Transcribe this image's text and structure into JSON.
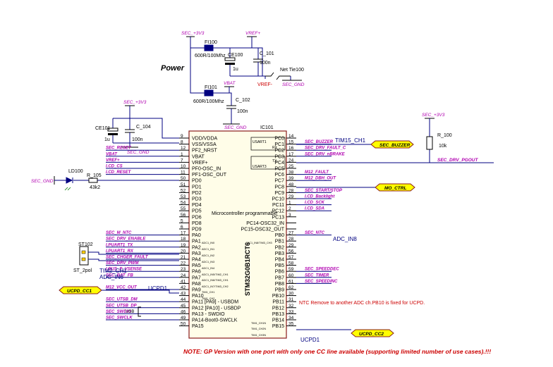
{
  "title": "Power",
  "colors": {
    "wire": "#000080",
    "netlabel": "#b000b0",
    "note": "#cc0000",
    "chip_fill": "#fffde8",
    "chip_outline": "#8a1c1c",
    "port_fill": "#ffff00"
  },
  "ic": {
    "designator": "IC101",
    "part": "STM32G0B1RCT6",
    "description": "Microcontroller programmable",
    "left_pins": [
      {
        "num": "9",
        "name": "VDD/VDDA",
        "net": ""
      },
      {
        "num": "8",
        "name": "VSS/VSSA",
        "net": ""
      },
      {
        "num": "12",
        "name": "PF2_NRST",
        "net": "SEC_RESET"
      },
      {
        "num": "1",
        "name": "VBAT",
        "net": "VBAT"
      },
      {
        "num": "7",
        "name": "VREF+",
        "net": "VREF+"
      },
      {
        "num": "10",
        "name": "PF0-OSC_IN",
        "net": "I.CD_CS"
      },
      {
        "num": "11",
        "name": "PF1-OSC_OUT",
        "net": "I.CD_RESET"
      },
      {
        "num": "50",
        "name": "PD0",
        "net": ""
      },
      {
        "num": "51",
        "name": "PD1",
        "net": ""
      },
      {
        "num": "52",
        "name": "PD2",
        "net": ""
      },
      {
        "num": "53",
        "name": "PD3",
        "net": ""
      },
      {
        "num": "54",
        "name": "PD4",
        "net": ""
      },
      {
        "num": "55",
        "name": "PD5",
        "net": ""
      },
      {
        "num": "56",
        "name": "PD6",
        "net": ""
      },
      {
        "num": "5",
        "name": "PD8",
        "net": ""
      },
      {
        "num": "6",
        "name": "PD9",
        "net": ""
      },
      {
        "num": "17",
        "name": "PA0",
        "net": "SEC_M_NTC"
      },
      {
        "num": "18",
        "name": "PA1",
        "net": "SEC_DRV_ENABLE"
      },
      {
        "num": "19",
        "name": "PA2",
        "net": "I.PUART1_TX"
      },
      {
        "num": "20",
        "name": "PA3",
        "net": "I.PUART1_RX"
      },
      {
        "num": "21",
        "name": "PA4",
        "net": "SEC_CHGER_FAULT"
      },
      {
        "num": "22",
        "name": "PA5",
        "net": "SEC_DRV_PWM"
      },
      {
        "num": "23",
        "name": "PA6",
        "net": "I.BUS_P_VSENSE"
      },
      {
        "num": "24",
        "name": "PA7",
        "net": "SEC_BAT_FB"
      },
      {
        "num": "41",
        "name": "PA8",
        "net": ""
      },
      {
        "num": "42",
        "name": "PA9",
        "net": "M12_VCC_OUT"
      },
      {
        "num": "43",
        "name": "PA10",
        "net": ""
      },
      {
        "num": "44",
        "name": "PA11 [PA9] - USBDM",
        "net": "SEC_UTSB_DM"
      },
      {
        "num": "45",
        "name": "PA12 [PA10] - USBDP",
        "net": "SEC_UTSB_DP"
      },
      {
        "num": "46",
        "name": "PA13 - SWDIO",
        "net": "SEC_SWDIO"
      },
      {
        "num": "49",
        "name": "PA14-Boot0-SWCLK",
        "net": "SEC_SWCLK"
      },
      {
        "num": "50",
        "name": "PA15",
        "net": ""
      }
    ],
    "right_pins": [
      {
        "num": "14",
        "name": "PC0",
        "net": ""
      },
      {
        "num": "15",
        "name": "PC1",
        "net": "SEC_BUZZER"
      },
      {
        "num": "16",
        "name": "PC2",
        "net": "SEC_DRV_FAULT_C"
      },
      {
        "num": "17",
        "name": "PC3",
        "net": "SEC_DRV_nBRAKE"
      },
      {
        "num": "24",
        "name": "PC4",
        "net": ""
      },
      {
        "num": "25",
        "name": "PC5",
        "net": "SEC_DRV_PGOUT"
      },
      {
        "num": "38",
        "name": "PC6",
        "net": "M12_FAULT"
      },
      {
        "num": "39",
        "name": "PC7",
        "net": "M12_DBH_OUT"
      },
      {
        "num": "48",
        "name": "PC8",
        "net": ""
      },
      {
        "num": "28",
        "name": "PC9",
        "net": "SEC_START/STOP"
      },
      {
        "num": "29",
        "name": "PC10",
        "net": "I.CD_Backlight"
      },
      {
        "num": "1",
        "name": "PC11",
        "net": "I.CD_SCK"
      },
      {
        "num": "2",
        "name": "PC12",
        "net": "I.CD_SDA"
      },
      {
        "num": "3",
        "name": "PC13",
        "net": ""
      },
      {
        "num": "",
        "name": "PC14-OSC32_IN",
        "net": ""
      },
      {
        "num": "",
        "name": "PC15-OSC32_OUT",
        "net": ""
      },
      {
        "num": "27",
        "name": "PB0",
        "net": "SEC_NTC"
      },
      {
        "num": "28",
        "name": "PB1",
        "net": ""
      },
      {
        "num": "29",
        "name": "PB2",
        "net": ""
      },
      {
        "num": "56",
        "name": "PB3",
        "net": ""
      },
      {
        "num": "57",
        "name": "PB4",
        "net": ""
      },
      {
        "num": "58",
        "name": "PB5",
        "net": ""
      },
      {
        "num": "59",
        "name": "PB6",
        "net": "SEC_SPEEDDEC"
      },
      {
        "num": "60",
        "name": "PB7",
        "net": "SEC_TIMER"
      },
      {
        "num": "61",
        "name": "PB8",
        "net": "SEC_SPEEDINC"
      },
      {
        "num": "62",
        "name": "PB9",
        "net": ""
      },
      {
        "num": "30",
        "name": "PB10",
        "net": ""
      },
      {
        "num": "31",
        "name": "PB11",
        "net": ""
      },
      {
        "num": "32",
        "name": "PB12",
        "net": ""
      },
      {
        "num": "33",
        "name": "PB13",
        "net": ""
      },
      {
        "num": "34",
        "name": "PB14",
        "net": ""
      },
      {
        "num": "35",
        "name": "PB15",
        "net": ""
      }
    ],
    "pin_functions": {
      "pa0": "ADC1_IN0",
      "pa1": "ADC1_IN1",
      "pa2": "ADC1_IN2",
      "pa3": "ADC1_IN3",
      "pa4": "ADC1_IN4",
      "pa5": "ADC1_IN5/TIM2_CH1",
      "pa6": "ADC1_IN6/TIM3_CH1",
      "pa7": "ADC1_IN7/TIM3_CH2",
      "pa8": "TIM1_CH1",
      "pa9": "TIM1_CH2",
      "pb0": "ADC1_IN8/TIM3_CH3",
      "pb13": "TIM1_CH1N",
      "pb14": "TIM1_CH2N",
      "pb15": "TIM1_CH3N",
      "usart_rx": "RX",
      "usart_tx": "TX",
      "usart1": "USART1",
      "usart3": "USART3"
    }
  },
  "components": {
    "fi100": {
      "ref": "FI100",
      "value": "600R/100Mhz"
    },
    "fi101": {
      "ref": "FI101",
      "value": "600R/100Mhz"
    },
    "ce100": {
      "ref": "CE100",
      "value": "1u"
    },
    "c101": {
      "ref": "C_101",
      "value": "100n"
    },
    "c102": {
      "ref": "C_102",
      "value": "100n"
    },
    "nettie": {
      "ref": "Net Tie100"
    },
    "ce101": {
      "ref": "CE101",
      "value": "1u"
    },
    "c104": {
      "ref": "C_104",
      "value": "100n"
    },
    "ld100": {
      "ref": "LD100"
    },
    "r105": {
      "ref": "R_105",
      "value": "43k2"
    },
    "r100": {
      "ref": "R_100",
      "value": "10k"
    },
    "st102": {
      "ref": "ST102",
      "value": "ST_2pol"
    }
  },
  "power_nets": {
    "sec3v3_a": "SEC_+3V3",
    "vref_plus": "VREF+",
    "vref_minus": "VREF-",
    "sec_gnd_a": "SEC_GND",
    "vbat": "VBAT",
    "sec_gnd_b": "SEC_GND",
    "sec3v3_b": "SEC_+3V3",
    "sec_gnd_c": "SEC_GND",
    "sec3v3_c": "SEC_+3V3",
    "sec_gnd_d": "SEC_GND"
  },
  "ports": {
    "sec_buzzer": "SEC_BUZZER",
    "mo_ctrl": "MO_CTRL",
    "ucpd_cc1": "UCPD_CC1",
    "ucpd_cc2": "UCPD_CC2"
  },
  "annotations": {
    "tim15_ch1": "TIM15_CH1",
    "adc_in8": "ADC_IN8",
    "tim2_ch1": "TIM2_CH1",
    "adc_in6": "ADC_IN6",
    "ucpd1_a": "UCPD1",
    "ucpd1_b": "UCPD1",
    "usb": "USB",
    "ntc_note": "NTC  Remove to another ADC ch.PB10 is fixed for UCPD.",
    "footer_note": "NOTE: GP Version with one port with only one CC line available (supporting limited number of use cases).!!!"
  }
}
